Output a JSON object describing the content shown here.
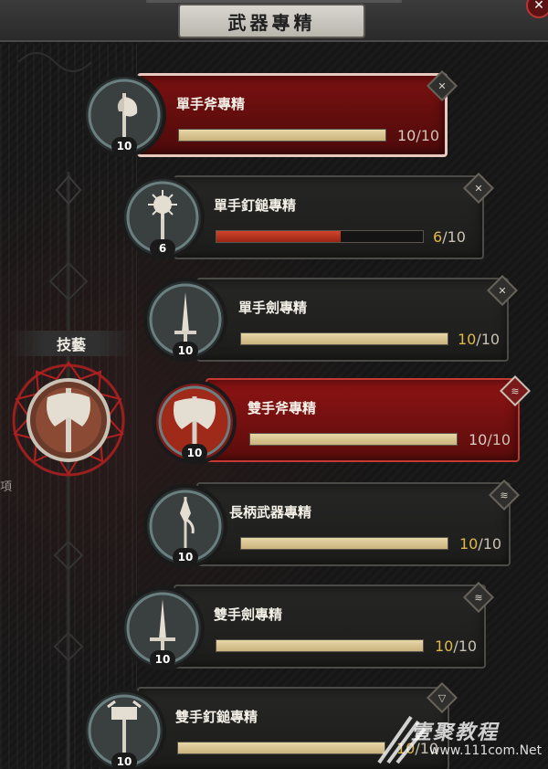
{
  "header": {
    "title": "武器專精",
    "close_icon": "close-icon"
  },
  "sidebar": {
    "category_label": "技藝",
    "edge_char": "項"
  },
  "colors": {
    "selected_panel": "#7a1111",
    "active_panel": "#8d1414",
    "bar_fill": "#c9b27c",
    "bar_fill_partial": "#9a2414",
    "rank_gold": "#e0b84a"
  },
  "skills": [
    {
      "name": "單手斧專精",
      "icon": "one-hand-axe-icon",
      "rank": "10",
      "current": "10",
      "max": "10",
      "progress": 1.0,
      "state": "selected",
      "corner_icon": "crossed-icon"
    },
    {
      "name": "單手釘鎚專精",
      "icon": "one-hand-mace-icon",
      "rank": "6",
      "current": "6",
      "max": "10",
      "progress": 0.6,
      "state": "normal",
      "corner_icon": "crossed-icon"
    },
    {
      "name": "單手劍專精",
      "icon": "one-hand-sword-icon",
      "rank": "10",
      "current": "10",
      "max": "10",
      "progress": 1.0,
      "state": "normal",
      "corner_icon": "crossed-icon"
    },
    {
      "name": "雙手斧專精",
      "icon": "two-hand-axe-icon",
      "rank": "10",
      "current": "10",
      "max": "10",
      "progress": 1.0,
      "state": "active",
      "corner_icon": "wave-icon"
    },
    {
      "name": "長柄武器專精",
      "icon": "polearm-icon",
      "rank": "10",
      "current": "10",
      "max": "10",
      "progress": 1.0,
      "state": "normal",
      "corner_icon": "wave-icon"
    },
    {
      "name": "雙手劍專精",
      "icon": "two-hand-sword-icon",
      "rank": "10",
      "current": "10",
      "max": "10",
      "progress": 1.0,
      "state": "normal",
      "corner_icon": "wave-icon"
    },
    {
      "name": "雙手釘鎚專精",
      "icon": "two-hand-mace-icon",
      "rank": "10",
      "current": "10",
      "max": "10",
      "progress": 1.0,
      "state": "normal",
      "corner_icon": "cup-icon"
    }
  ],
  "watermark": {
    "text": "壹聚教程",
    "url": "www.111com.Net"
  }
}
